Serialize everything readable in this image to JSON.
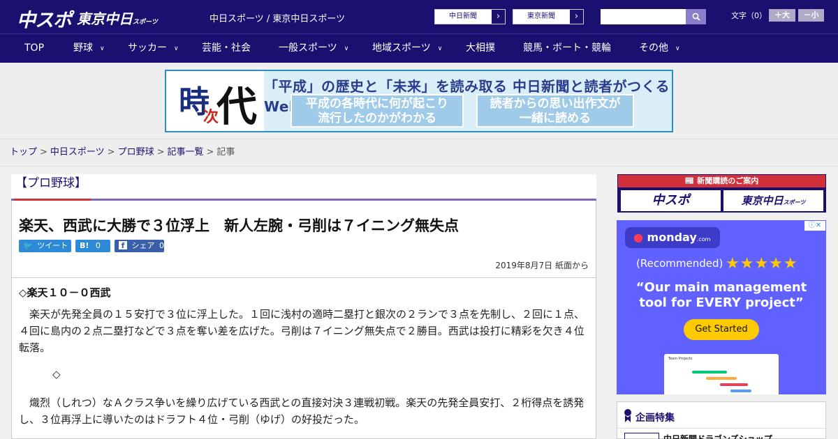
{
  "header": {
    "logo_main": "中スポ",
    "logo_sub": "東京中日",
    "logo_sub_small": "スポーツ",
    "site_names": "中日スポーツ / 東京中日スポーツ",
    "paper_links": [
      {
        "label": "中日新聞",
        "arrow": "›"
      },
      {
        "label": "東京新聞",
        "arrow": "›"
      }
    ],
    "search_placeholder": "",
    "font_label": "文字（0）",
    "font_larger": "＋大",
    "font_smaller": "－小"
  },
  "nav": [
    {
      "label": "TOP",
      "has_menu": false
    },
    {
      "label": "野球",
      "has_menu": true
    },
    {
      "label": "サッカー",
      "has_menu": true
    },
    {
      "label": "芸能・社会",
      "has_menu": false
    },
    {
      "label": "一般スポーツ",
      "has_menu": true
    },
    {
      "label": "地域スポーツ",
      "has_menu": true
    },
    {
      "label": "大相撲",
      "has_menu": false
    },
    {
      "label": "競馬・ボート・競輪",
      "has_menu": false
    },
    {
      "label": "その他",
      "has_menu": true
    }
  ],
  "banner": {
    "kanji_1": "時",
    "kanji_2": "次",
    "kanji_3": "代",
    "headline": "「平成」の歴史と「未来」を読み取る 中日新聞と読者がつくるWebサイト",
    "box_1": "平成の各時代に何が起こり\n流行したのかがわかる",
    "box_2": "読者からの思い出作文が\n一緒に読める"
  },
  "breadcrumb": {
    "items": [
      "トップ",
      "中日スポーツ",
      "プロ野球",
      "記事一覧"
    ],
    "current": "記事",
    "separator": ">"
  },
  "article": {
    "category": "【プロ野球】",
    "headline": "楽天、西武に大勝で３位浮上　新人左腕・弓削は７イニング無失点",
    "share": {
      "tweet": "ツイート",
      "hatena": "B!",
      "hatena_count": "0",
      "facebook": "シェア",
      "facebook_count": "0"
    },
    "dateline": "2019年8月7日 紙面から",
    "lead": "◇楽天１０－０西武",
    "paragraph_1": "楽天が先発全員の１５安打で３位に浮上した。１回に浅村の適時二塁打と銀次の２ランで３点を先制し、２回に１点、４回に島内の２点二塁打などで３点を奪い差を広げた。弓削は７イニング無失点で２勝目。西武は投打に精彩を欠き４位転落。",
    "diamond": "◇",
    "paragraph_2": "熾烈（しれつ）なＡクラス争いを繰り広げている西武との直接対決３連戦初戦。楽天の先発全員安打、２桁得点を誘発し、３位再浮上に導いたのはドラフト４位・弓削（ゆげ）の好投だった。"
  },
  "sidebar": {
    "subscribe_head": "新聞購読のご案内",
    "subscribe_logo_1": "中スポ",
    "subscribe_logo_2": "東京中日",
    "subscribe_logo_2_small": "スポーツ",
    "ad": {
      "brand": "monday",
      "brand_suffix": ".com",
      "recommended": "(Recommended)",
      "stars": "★★★★★",
      "quote": "“Our main management tool for EVERY project”",
      "cta": "Get Started",
      "screenshot_title": "Team Projects",
      "adchoice": "ⓘ✕",
      "colors": {
        "bg": "#6161ff",
        "cta": "#ffcb00"
      }
    },
    "feature_title": "企画特集",
    "feature_item": "中日新聞ドラゴンズショップ"
  },
  "colors": {
    "brand": "#1a1070",
    "accent": "#d0303a",
    "purple": "#7b67b6"
  }
}
